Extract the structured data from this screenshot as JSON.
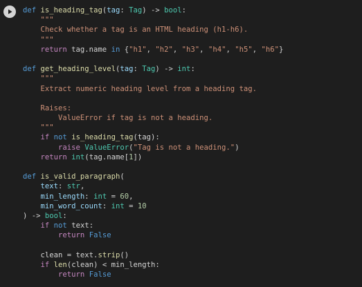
{
  "run_button": {
    "icon": "play-icon"
  },
  "colors": {
    "background": "#1e1e1e",
    "keyword": "#569cd6",
    "function": "#dcdcaa",
    "string": "#ce9178",
    "number": "#b5cea8",
    "type": "#4ec9b0",
    "default": "#d4d4d4"
  },
  "code_lines": [
    [
      [
        "kw",
        "def"
      ],
      [
        "plain",
        " "
      ],
      [
        "fn",
        "is_heading_tag"
      ],
      [
        "plain",
        "("
      ],
      [
        "param",
        "tag"
      ],
      [
        "plain",
        ": "
      ],
      [
        "type",
        "Tag"
      ],
      [
        "plain",
        ") -> "
      ],
      [
        "type",
        "bool"
      ],
      [
        "plain",
        ":"
      ]
    ],
    [
      [
        "str",
        "    \"\"\""
      ]
    ],
    [
      [
        "str",
        "    Check whether a tag is an HTML heading (h1-h6)."
      ]
    ],
    [
      [
        "str",
        "    \"\"\""
      ]
    ],
    [
      [
        "ctrl",
        "    return"
      ],
      [
        "plain",
        " tag.name "
      ],
      [
        "kw",
        "in"
      ],
      [
        "plain",
        " {"
      ],
      [
        "str",
        "\"h1\""
      ],
      [
        "plain",
        ", "
      ],
      [
        "str",
        "\"h2\""
      ],
      [
        "plain",
        ", "
      ],
      [
        "str",
        "\"h3\""
      ],
      [
        "plain",
        ", "
      ],
      [
        "str",
        "\"h4\""
      ],
      [
        "plain",
        ", "
      ],
      [
        "str",
        "\"h5\""
      ],
      [
        "plain",
        ", "
      ],
      [
        "str",
        "\"h6\""
      ],
      [
        "plain",
        "}"
      ]
    ],
    [
      [
        "plain",
        ""
      ]
    ],
    [
      [
        "kw",
        "def"
      ],
      [
        "plain",
        " "
      ],
      [
        "fn",
        "get_heading_level"
      ],
      [
        "plain",
        "("
      ],
      [
        "param",
        "tag"
      ],
      [
        "plain",
        ": "
      ],
      [
        "type",
        "Tag"
      ],
      [
        "plain",
        ") -> "
      ],
      [
        "type",
        "int"
      ],
      [
        "plain",
        ":"
      ]
    ],
    [
      [
        "str",
        "    \"\"\""
      ]
    ],
    [
      [
        "str",
        "    Extract numeric heading level from a heading tag."
      ]
    ],
    [
      [
        "plain",
        ""
      ]
    ],
    [
      [
        "str",
        "    Raises:"
      ]
    ],
    [
      [
        "str",
        "        ValueError if tag is not a heading."
      ]
    ],
    [
      [
        "str",
        "    \"\"\""
      ]
    ],
    [
      [
        "ctrl",
        "    if"
      ],
      [
        "plain",
        " "
      ],
      [
        "kw",
        "not"
      ],
      [
        "plain",
        " "
      ],
      [
        "fn",
        "is_heading_tag"
      ],
      [
        "plain",
        "(tag):"
      ]
    ],
    [
      [
        "ctrl",
        "        raise"
      ],
      [
        "plain",
        " "
      ],
      [
        "type",
        "ValueError"
      ],
      [
        "plain",
        "("
      ],
      [
        "str",
        "\"Tag is not a heading.\""
      ],
      [
        "plain",
        ")"
      ]
    ],
    [
      [
        "ctrl",
        "    return"
      ],
      [
        "plain",
        " "
      ],
      [
        "type",
        "int"
      ],
      [
        "plain",
        "(tag.name["
      ],
      [
        "num",
        "1"
      ],
      [
        "plain",
        "])"
      ]
    ],
    [
      [
        "plain",
        ""
      ]
    ],
    [
      [
        "kw",
        "def"
      ],
      [
        "plain",
        " "
      ],
      [
        "fn",
        "is_valid_paragraph"
      ],
      [
        "plain",
        "("
      ]
    ],
    [
      [
        "param",
        "    text"
      ],
      [
        "plain",
        ": "
      ],
      [
        "type",
        "str"
      ],
      [
        "plain",
        ","
      ]
    ],
    [
      [
        "param",
        "    min_length"
      ],
      [
        "plain",
        ": "
      ],
      [
        "type",
        "int"
      ],
      [
        "plain",
        " = "
      ],
      [
        "num",
        "60"
      ],
      [
        "plain",
        ","
      ]
    ],
    [
      [
        "param",
        "    min_word_count"
      ],
      [
        "plain",
        ": "
      ],
      [
        "type",
        "int"
      ],
      [
        "plain",
        " = "
      ],
      [
        "num",
        "10"
      ]
    ],
    [
      [
        "plain",
        ") -> "
      ],
      [
        "type",
        "bool"
      ],
      [
        "plain",
        ":"
      ]
    ],
    [
      [
        "ctrl",
        "    if"
      ],
      [
        "plain",
        " "
      ],
      [
        "kw",
        "not"
      ],
      [
        "plain",
        " text:"
      ]
    ],
    [
      [
        "ctrl",
        "        return"
      ],
      [
        "plain",
        " "
      ],
      [
        "kw",
        "False"
      ]
    ],
    [
      [
        "plain",
        ""
      ]
    ],
    [
      [
        "plain",
        "    clean = text."
      ],
      [
        "fn",
        "strip"
      ],
      [
        "plain",
        "()"
      ]
    ],
    [
      [
        "ctrl",
        "    if"
      ],
      [
        "plain",
        " "
      ],
      [
        "fn",
        "len"
      ],
      [
        "plain",
        "(clean) < min_length:"
      ]
    ],
    [
      [
        "ctrl",
        "        return"
      ],
      [
        "plain",
        " "
      ],
      [
        "kw",
        "False"
      ]
    ]
  ]
}
